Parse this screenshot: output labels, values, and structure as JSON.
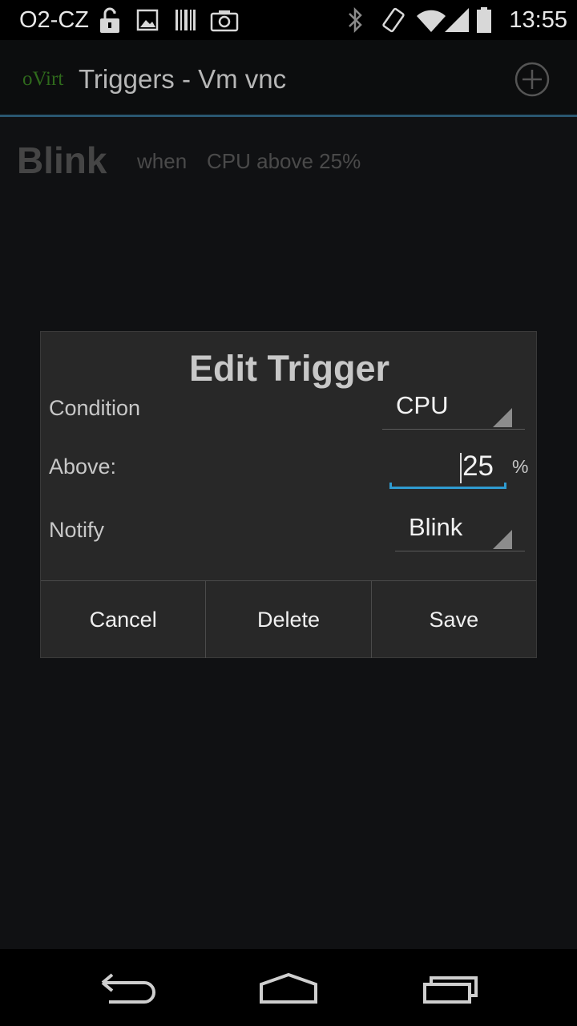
{
  "status_bar": {
    "carrier": "O2-CZ",
    "time": "13:55",
    "icons": [
      "unlock-icon",
      "image-icon",
      "barcode-icon",
      "camera-icon",
      "bluetooth-icon",
      "vibrate-icon",
      "wifi-icon",
      "signal-icon",
      "battery-icon"
    ]
  },
  "action_bar": {
    "logo": "oVirt",
    "title": "Triggers - Vm vnc",
    "add_icon": "add-circle-icon",
    "logo_color": "#2f6a1c",
    "accent_color": "#2a5670"
  },
  "trigger_list": [
    {
      "notify": "Blink",
      "when": "when",
      "condition": "CPU above 25%"
    }
  ],
  "dialog": {
    "title": "Edit Trigger",
    "condition_label": "Condition",
    "condition_value": "CPU",
    "above_label": "Above:",
    "above_value": "25",
    "unit": "%",
    "notify_label": "Notify",
    "notify_value": "Blink",
    "buttons": {
      "cancel": "Cancel",
      "delete": "Delete",
      "save": "Save"
    },
    "focus_color": "#2f9bd0"
  },
  "nav_bar": {
    "icons": [
      "back-icon",
      "home-icon",
      "recent-apps-icon"
    ]
  }
}
